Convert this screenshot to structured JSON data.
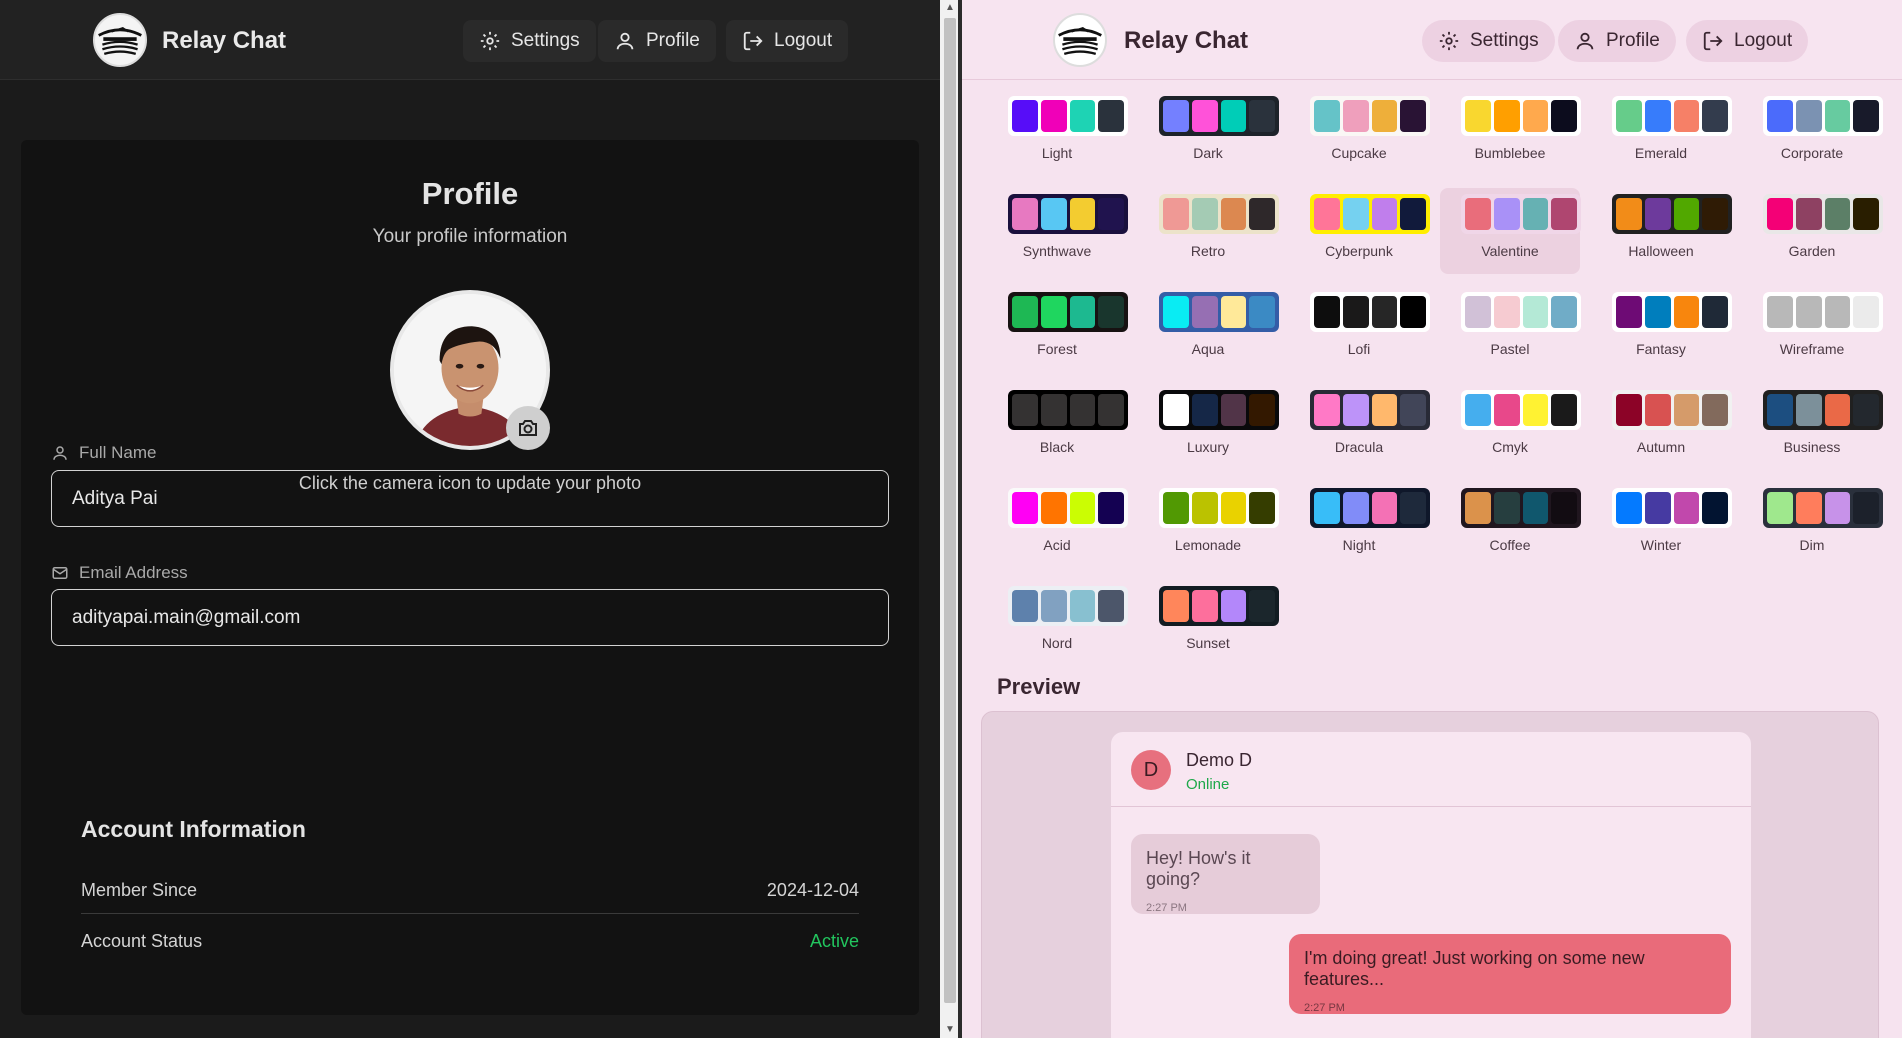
{
  "app": {
    "name": "Relay Chat"
  },
  "nav": {
    "settings": "Settings",
    "profile": "Profile",
    "logout": "Logout"
  },
  "profile": {
    "title": "Profile",
    "subtitle": "Your profile information",
    "photo_hint": "Click the camera icon to update your photo",
    "full_name_label": "Full Name",
    "full_name_value": "Aditya Pai",
    "email_label": "Email Address",
    "email_value": "adityapai.main@gmail.com"
  },
  "account": {
    "title": "Account Information",
    "member_since_label": "Member Since",
    "member_since_value": "2024-12-04",
    "status_label": "Account Status",
    "status_value": "Active",
    "status_color": "#22c55e"
  },
  "themes": [
    {
      "name": "Light",
      "colors": [
        "#570df8",
        "#f000b8",
        "#1ed3b4",
        "#2a323c"
      ],
      "bg": "#ffffff"
    },
    {
      "name": "Dark",
      "colors": [
        "#7480ff",
        "#ff52d9",
        "#00cdb7",
        "#2a323c"
      ],
      "bg": "#1d232a"
    },
    {
      "name": "Cupcake",
      "colors": [
        "#65c3c8",
        "#ef9fbc",
        "#eeaf3a",
        "#291334"
      ],
      "bg": "#faf7f5"
    },
    {
      "name": "Bumblebee",
      "colors": [
        "#f9d72f",
        "#ff9f00",
        "#ffa94d",
        "#0c0c1d"
      ],
      "bg": "#ffffff"
    },
    {
      "name": "Emerald",
      "colors": [
        "#66cc8a",
        "#377cfb",
        "#f68067",
        "#333c4d"
      ],
      "bg": "#ffffff"
    },
    {
      "name": "Corporate",
      "colors": [
        "#4b6bfb",
        "#7b92b2",
        "#67cba0",
        "#181a2a"
      ],
      "bg": "#ffffff"
    },
    {
      "name": "Synthwave",
      "colors": [
        "#e779c1",
        "#58c7f3",
        "#f3cc30",
        "#20134e"
      ],
      "bg": "#1a103d"
    },
    {
      "name": "Retro",
      "colors": [
        "#ef9995",
        "#a4cbb4",
        "#dc8850",
        "#2e282a"
      ],
      "bg": "#ece3ca"
    },
    {
      "name": "Cyberpunk",
      "colors": [
        "#ff7598",
        "#75d1f0",
        "#c07eec",
        "#111a3b"
      ],
      "bg": "#ffee00"
    },
    {
      "name": "Valentine",
      "colors": [
        "#e96d7b",
        "#a991f7",
        "#66b1b3",
        "#af4670"
      ],
      "bg": "#f0d6e8"
    },
    {
      "name": "Halloween",
      "colors": [
        "#f28c18",
        "#6d3a9c",
        "#51a800",
        "#2f1b05"
      ],
      "bg": "#212121"
    },
    {
      "name": "Garden",
      "colors": [
        "#f40076",
        "#8e4162",
        "#5c7f67",
        "#291e00"
      ],
      "bg": "#e9e7e7"
    },
    {
      "name": "Forest",
      "colors": [
        "#1eb854",
        "#1fd65f",
        "#1db990",
        "#19362d"
      ],
      "bg": "#171212"
    },
    {
      "name": "Aqua",
      "colors": [
        "#09ecf3",
        "#966fb3",
        "#ffe999",
        "#3b8ac4"
      ],
      "bg": "#345da7"
    },
    {
      "name": "Lofi",
      "colors": [
        "#0d0d0d",
        "#1a1919",
        "#262626",
        "#000000"
      ],
      "bg": "#ffffff"
    },
    {
      "name": "Pastel",
      "colors": [
        "#d1c1d7",
        "#f6cbd1",
        "#b4e9d6",
        "#70acc7"
      ],
      "bg": "#ffffff"
    },
    {
      "name": "Fantasy",
      "colors": [
        "#6e0b75",
        "#007ebd",
        "#f8860d",
        "#1f2937"
      ],
      "bg": "#ffffff"
    },
    {
      "name": "Wireframe",
      "colors": [
        "#b8b8b8",
        "#b8b8b8",
        "#b8b8b8",
        "#ebebeb"
      ],
      "bg": "#ffffff"
    },
    {
      "name": "Black",
      "colors": [
        "#343232",
        "#343232",
        "#343232",
        "#343232"
      ],
      "bg": "#000000"
    },
    {
      "name": "Luxury",
      "colors": [
        "#ffffff",
        "#152747",
        "#513448",
        "#331800"
      ],
      "bg": "#09090b"
    },
    {
      "name": "Dracula",
      "colors": [
        "#ff79c6",
        "#bd93f9",
        "#ffb86c",
        "#414558"
      ],
      "bg": "#282a36"
    },
    {
      "name": "Cmyk",
      "colors": [
        "#45aeee",
        "#e8488a",
        "#fff232",
        "#1a1a1a"
      ],
      "bg": "#ffffff"
    },
    {
      "name": "Autumn",
      "colors": [
        "#8c0327",
        "#d85251",
        "#d59b6a",
        "#826a5c"
      ],
      "bg": "#f1f1f1"
    },
    {
      "name": "Business",
      "colors": [
        "#1c4e80",
        "#7c909a",
        "#ea6947",
        "#23282e"
      ],
      "bg": "#202020"
    },
    {
      "name": "Acid",
      "colors": [
        "#ff00f4",
        "#ff7400",
        "#cbfd03",
        "#140152"
      ],
      "bg": "#fafafa"
    },
    {
      "name": "Lemonade",
      "colors": [
        "#519903",
        "#bbc200",
        "#e9d200",
        "#353d00"
      ],
      "bg": "#ffffff"
    },
    {
      "name": "Night",
      "colors": [
        "#38bdf8",
        "#818cf8",
        "#f471b5",
        "#1e293b"
      ],
      "bg": "#0f172a"
    },
    {
      "name": "Coffee",
      "colors": [
        "#db924b",
        "#263e3f",
        "#10576d",
        "#120c12"
      ],
      "bg": "#20161f"
    },
    {
      "name": "Winter",
      "colors": [
        "#047aff",
        "#463aa2",
        "#c148ac",
        "#021431"
      ],
      "bg": "#ffffff"
    },
    {
      "name": "Dim",
      "colors": [
        "#9fe88d",
        "#ff7d5c",
        "#c792e9",
        "#1c212b"
      ],
      "bg": "#2a303c"
    },
    {
      "name": "Nord",
      "colors": [
        "#5e81ac",
        "#81a1c1",
        "#88c0d0",
        "#4c566a"
      ],
      "bg": "#eceff4"
    },
    {
      "name": "Sunset",
      "colors": [
        "#ff865b",
        "#fd6f9c",
        "#b387fa",
        "#1b262c"
      ],
      "bg": "#121c22"
    }
  ],
  "selected_theme": "Valentine",
  "preview": {
    "title": "Preview",
    "contact_initial": "D",
    "contact_name": "Demo D",
    "contact_status": "Online",
    "msg_in_text": "Hey! How's it going?",
    "msg_in_time": "2:27 PM",
    "msg_out_text": "I'm doing great! Just working on some new features...",
    "msg_out_time": "2:27 PM"
  }
}
